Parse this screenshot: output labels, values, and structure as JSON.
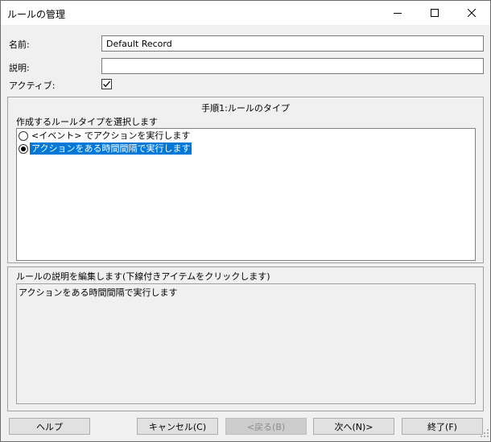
{
  "window": {
    "title": "ルールの管理"
  },
  "form": {
    "name_label": "名前:",
    "name_value": "Default Record",
    "desc_label": "説明:",
    "desc_value": "",
    "active_label": "アクティブ:",
    "active_checked": true
  },
  "step": {
    "title": "手順1:ルールのタイプ",
    "prompt": "作成するルールタイプを選択します",
    "options": [
      {
        "label": "<イベント> でアクションを実行します",
        "selected": false
      },
      {
        "label": "アクションをある時間間隔で実行します",
        "selected": true
      }
    ]
  },
  "rule_desc": {
    "title": "ルールの説明を編集します(下線付きアイテムをクリックします)",
    "text": "アクションをある時間間隔で実行します"
  },
  "buttons": {
    "help": "ヘルプ",
    "cancel": "キャンセル(C)",
    "back": "<戻る(B)",
    "next": "次へ(N)>",
    "finish": "終了(F)"
  },
  "colors": {
    "selection": "#0078d7",
    "window_bg": "#f0f0f0"
  }
}
